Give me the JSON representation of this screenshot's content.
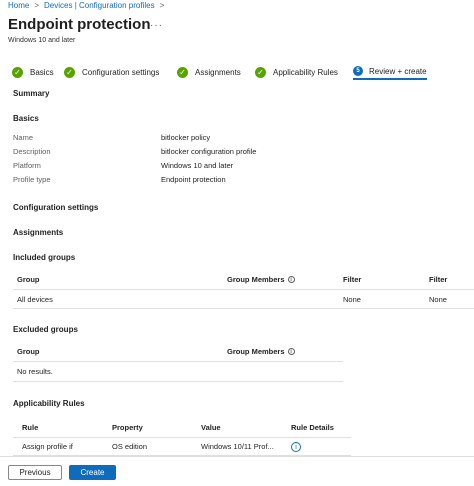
{
  "breadcrumb": {
    "items": [
      "Home",
      "Devices | Configuration profiles"
    ],
    "separator": ">"
  },
  "header": {
    "title": "Endpoint protection",
    "more": "···",
    "subtitle": "Windows 10 and later"
  },
  "wizard": {
    "steps": [
      {
        "label": "Basics",
        "state": "done",
        "mark": "✓"
      },
      {
        "label": "Configuration settings",
        "state": "done",
        "mark": "✓"
      },
      {
        "label": "Assignments",
        "state": "done",
        "mark": "✓"
      },
      {
        "label": "Applicability Rules",
        "state": "done",
        "mark": "✓"
      },
      {
        "label": "Review + create",
        "state": "active",
        "mark": "5"
      }
    ]
  },
  "summary": {
    "title": "Summary",
    "basics": {
      "title": "Basics",
      "rows": [
        {
          "label": "Name",
          "value": "bitlocker policy"
        },
        {
          "label": "Description",
          "value": "bitlocker configuration profile"
        },
        {
          "label": "Platform",
          "value": "Windows 10 and later"
        },
        {
          "label": "Profile type",
          "value": "Endpoint protection"
        }
      ]
    },
    "config_settings_title": "Configuration settings",
    "assignments_title": "Assignments",
    "included": {
      "title": "Included groups",
      "headers": [
        "Group",
        "Group Members",
        "Filter",
        "Filter"
      ],
      "rows": [
        [
          "All devices",
          "",
          "None",
          "None"
        ]
      ]
    },
    "excluded": {
      "title": "Excluded groups",
      "headers": [
        "Group",
        "Group Members"
      ],
      "empty": "No results."
    },
    "applicability": {
      "title": "Applicability Rules",
      "headers": [
        "Rule",
        "Property",
        "Value",
        "Rule Details"
      ],
      "rows": [
        [
          "Assign profile if",
          "OS edition",
          "Windows 10/11 Prof..."
        ]
      ]
    }
  },
  "footer": {
    "previous": "Previous",
    "create": "Create"
  },
  "colors": {
    "accent": "#0f6cbd",
    "success": "#57a300"
  }
}
